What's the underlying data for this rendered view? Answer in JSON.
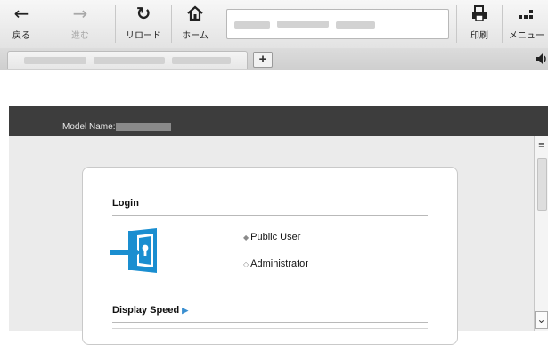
{
  "toolbar": {
    "back_icon": "←",
    "back_label": "戻る",
    "forward_icon": "→",
    "forward_label": "進む",
    "reload_icon": "↻",
    "reload_label": "リロード",
    "home_icon": "⌂",
    "home_label": "ホーム",
    "print_label": "印刷",
    "menu_label": "メニュー"
  },
  "tabs": {
    "new_tab_label": "+"
  },
  "page": {
    "model_name_label": "Model Name:",
    "login_heading": "Login",
    "options": [
      "Public User",
      "Administrator"
    ],
    "selected_option": "Public User",
    "display_speed_label": "Display Speed"
  },
  "colors": {
    "accent": "#1a8ed0",
    "dark_bar": "#3d3d3d"
  }
}
